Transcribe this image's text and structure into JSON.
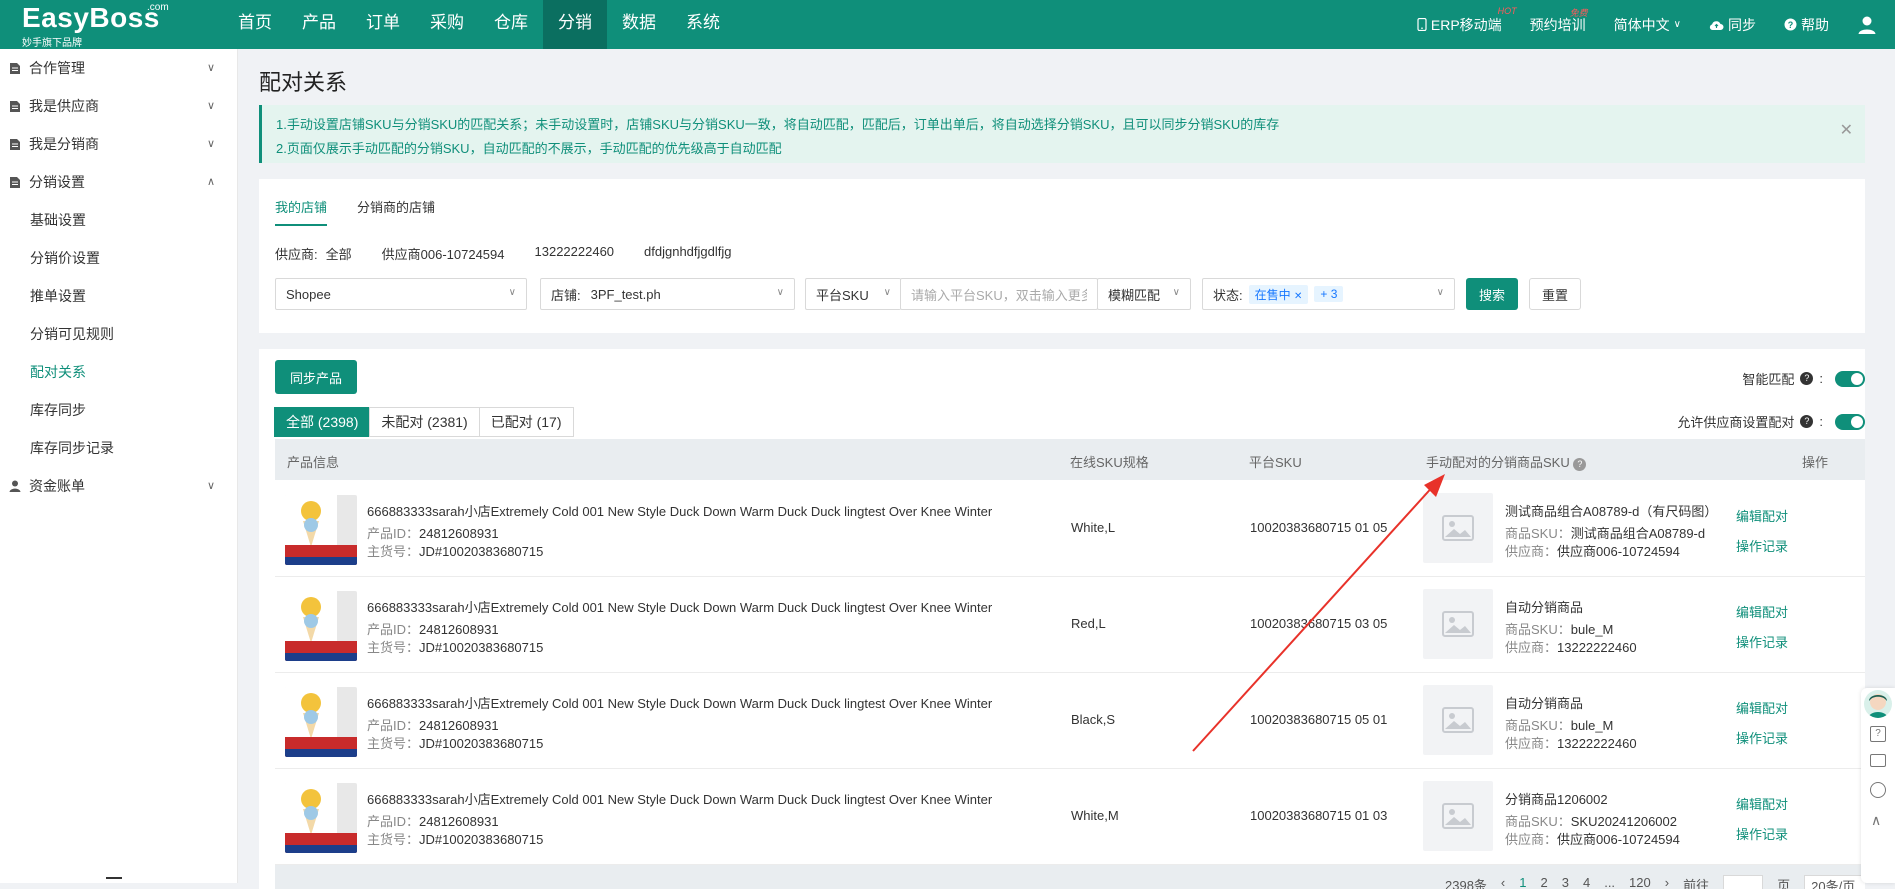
{
  "brand": {
    "name": "EasyBoss",
    "dotcom": ".com",
    "sub": "妙手旗下品牌"
  },
  "nav": [
    "首页",
    "产品",
    "订单",
    "采购",
    "仓库",
    "分销",
    "数据",
    "系统"
  ],
  "nav_active": 5,
  "topright": {
    "erp": "ERP移动端",
    "erp_badge": "HOT",
    "training": "预约培训",
    "training_badge": "免费",
    "lang": "简体中文",
    "sync": "同步",
    "help": "帮助"
  },
  "sidebar": {
    "groups": [
      "合作管理",
      "我是供应商",
      "我是分销商",
      "分销设置",
      "资金账单"
    ],
    "items": [
      "基础设置",
      "分销价设置",
      "推单设置",
      "分销可见规则",
      "配对关系",
      "库存同步",
      "库存同步记录"
    ]
  },
  "page": {
    "title": "配对关系",
    "alert1": "1.手动设置店铺SKU与分销SKU的匹配关系；未手动设置时，店铺SKU与分销SKU一致，将自动匹配，匹配后，订单出单后，将自动选择分销SKU，且可以同步分销SKU的库存",
    "alert2": "2.页面仅展示手动匹配的分销SKU，自动匹配的不展示，手动匹配的优先级高于自动匹配"
  },
  "filter": {
    "tab_mine": "我的店铺",
    "tab_dist": "分销商的店铺",
    "supplier_label": "供应商:",
    "suppliers": [
      "全部",
      "供应商006-10724594",
      "13222222460",
      "dfdjgnhdfjgdlfjg"
    ],
    "platform": "Shopee",
    "shop_label": "店铺:",
    "shop_value": "3PF_test.ph",
    "sku_type": "平台SKU",
    "sku_placeholder": "请输入平台SKU，双击输入更多",
    "match_mode": "模糊匹配",
    "status_label": "状态:",
    "status_tag": "在售中",
    "status_more": "+ 3",
    "search": "搜索",
    "reset": "重置"
  },
  "list": {
    "sync_btn": "同步产品",
    "smart_match": "智能匹配",
    "allow_supplier": "允许供应商设置配对",
    "segments": [
      "全部 (2398)",
      "未配对 (2381)",
      "已配对 (17)"
    ],
    "headers": [
      "产品信息",
      "在线SKU规格",
      "平台SKU",
      "手动配对的分销商品SKU",
      "操作"
    ],
    "label_pid": "产品ID：",
    "label_item": "主货号：",
    "label_dsku": "商品SKU：",
    "label_dsup": "供应商：",
    "op_edit": "编辑配对",
    "op_log": "操作记录",
    "rows": [
      {
        "name": "666883333sarah小店Extremely Cold 001 New Style Duck Down Warm Duck Duck lingtest Over Knee Winter",
        "pid": "24812608931",
        "item": "JD#10020383680715",
        "spec": "White,L",
        "psku": "10020383680715 01 05",
        "dname": "测试商品组合A08789-d（有尺码图）",
        "dsku": "测试商品组合A08789-d",
        "dsup": "供应商006-10724594"
      },
      {
        "name": "666883333sarah小店Extremely Cold 001 New Style Duck Down Warm Duck Duck lingtest Over Knee Winter",
        "pid": "24812608931",
        "item": "JD#10020383680715",
        "spec": "Red,L",
        "psku": "10020383680715 03 05",
        "dname": "自动分销商品",
        "dsku": "bule_M",
        "dsup": "13222222460"
      },
      {
        "name": "666883333sarah小店Extremely Cold 001 New Style Duck Down Warm Duck Duck lingtest Over Knee Winter",
        "pid": "24812608931",
        "item": "JD#10020383680715",
        "spec": "Black,S",
        "psku": "10020383680715 05 01",
        "dname": "自动分销商品",
        "dsku": "bule_M",
        "dsup": "13222222460"
      },
      {
        "name": "666883333sarah小店Extremely Cold 001 New Style Duck Down Warm Duck Duck lingtest Over Knee Winter",
        "pid": "24812608931",
        "item": "JD#10020383680715",
        "spec": "White,M",
        "psku": "10020383680715 01 03",
        "dname": "分销商品1206002",
        "dsku": "SKU20241206002",
        "dsup": "供应商006-10724594"
      }
    ]
  },
  "pager": {
    "total": "2398条",
    "pages": [
      "1",
      "2",
      "3",
      "4",
      "...",
      "120"
    ],
    "goto": "前往",
    "page_unit": "页",
    "page_size": "20条/页"
  },
  "colors": {
    "brand": "#0f8f7a",
    "arrow": "#e8322a"
  }
}
